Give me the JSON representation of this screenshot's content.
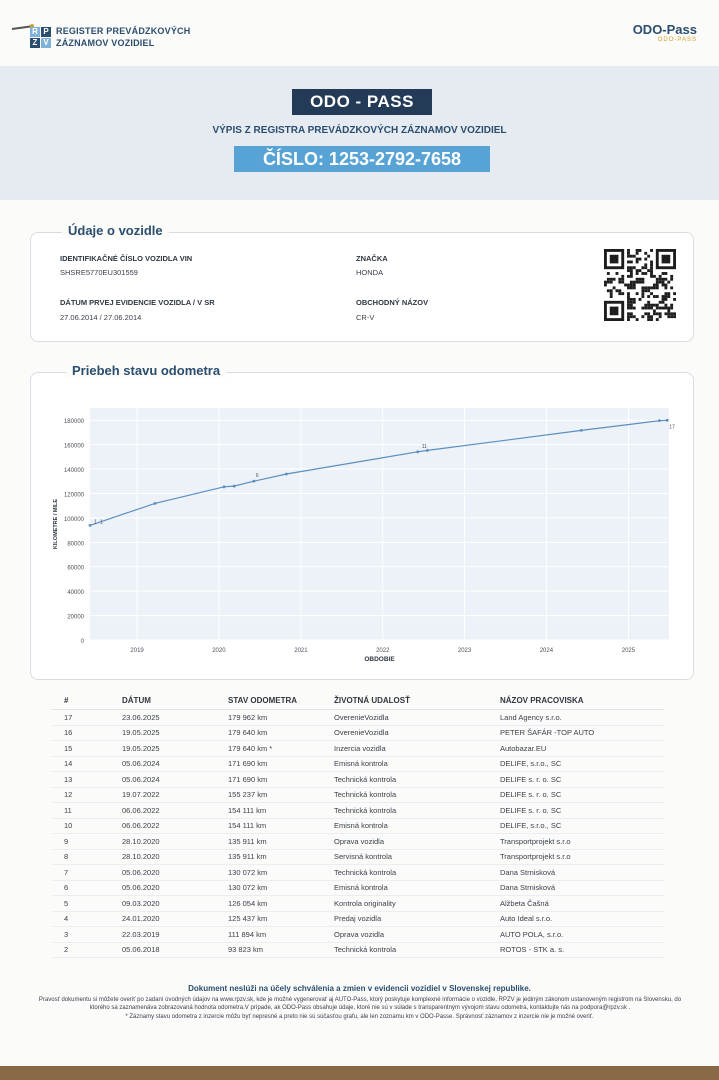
{
  "header": {
    "register_line1": "REGISTER PREVÁDZKOVÝCH",
    "register_line2": "ZÁZNAMOV VOZIDIEL",
    "odo_logo": "ODO-Pass",
    "odo_logo_sub": "ODO-PASS"
  },
  "title_block": {
    "badge": "ODO - PASS",
    "subtitle": "VÝPIS Z REGISTRA PREVÁDZKOVÝCH ZÁZNAMOV VOZIDIEL",
    "number": "ČÍSLO: 1253-2792-7658"
  },
  "vehicle": {
    "section_title": "Údaje o vozidle",
    "vin_label": "IDENTIFIKAČNÉ ČÍSLO VOZIDLA VIN",
    "vin_value": "SHSRE5770EU301559",
    "brand_label": "ZNAČKA",
    "brand_value": "HONDA",
    "first_reg_label": "DÁTUM PRVEJ EVIDENCIE VOZIDLA / V SR",
    "first_reg_value": "27.06.2014 / 27.06.2014",
    "trade_name_label": "OBCHODNÝ NÁZOV",
    "trade_name_value": "CR-V"
  },
  "odometer_section_title": "Priebeh stavu odometra",
  "chart_data": {
    "type": "line",
    "title": "",
    "xlabel": "OBDOBIE",
    "ylabel": "KILOMETRE / MILE",
    "ylim": [
      0,
      190000
    ],
    "xlim": [
      "2018-06-05",
      "2025-07-01"
    ],
    "x_ticks": [
      "2019",
      "2020",
      "2021",
      "2022",
      "2023",
      "2024",
      "2025"
    ],
    "y_ticks": [
      "0",
      "20000",
      "40000",
      "60000",
      "80000",
      "100000",
      "120000",
      "140000",
      "160000",
      "180000"
    ],
    "grid": true,
    "point_labels": [
      "1",
      "1",
      "6",
      "11",
      "17"
    ],
    "series": [
      {
        "color": "#5a8fc0",
        "points": [
          {
            "x": "2018-06-05",
            "y": 93823
          },
          {
            "x": "2019-03-22",
            "y": 111894
          },
          {
            "x": "2020-01-24",
            "y": 125437
          },
          {
            "x": "2020-03-09",
            "y": 126054
          },
          {
            "x": "2020-06-05",
            "y": 130072
          },
          {
            "x": "2020-10-28",
            "y": 135911
          },
          {
            "x": "2022-06-06",
            "y": 154111
          },
          {
            "x": "2022-07-19",
            "y": 155237
          },
          {
            "x": "2024-06-05",
            "y": 171690
          },
          {
            "x": "2025-05-19",
            "y": 179640
          },
          {
            "x": "2025-06-23",
            "y": 179962
          }
        ]
      }
    ]
  },
  "history": {
    "headers": [
      "#",
      "DÁTUM",
      "STAV ODOMETRA",
      "ŽIVOTNÁ UDALOSŤ",
      "NÁZOV PRACOVISKA"
    ],
    "rows": [
      [
        "17",
        "23.06.2025",
        "179 962 km",
        "OverenieVozidla",
        "Land Agency s.r.o."
      ],
      [
        "16",
        "19.05.2025",
        "179 640 km",
        "OverenieVozidla",
        "PETER ŠAFÁR -TOP AUTO"
      ],
      [
        "15",
        "19.05.2025",
        "179 640 km *",
        "Inzercia vozidla",
        "Autobazar.EU"
      ],
      [
        "14",
        "05.06.2024",
        "171 690 km",
        "Emisná kontrola",
        "DELIFE, s.r.o., SC"
      ],
      [
        "13",
        "05.06.2024",
        "171 690 km",
        "Technická kontrola",
        "DELIFE s. r. o. SC"
      ],
      [
        "12",
        "19.07.2022",
        "155 237 km",
        "Technická kontrola",
        "DELIFE s. r. o. SC"
      ],
      [
        "11",
        "06.06.2022",
        "154 111 km",
        "Technická kontrola",
        "DELIFE s. r. o. SC"
      ],
      [
        "10",
        "06.06.2022",
        "154 111 km",
        "Emisná kontrola",
        "DELIFE, s.r.o., SC"
      ],
      [
        "9",
        "28.10.2020",
        "135 911 km",
        "Oprava vozidla",
        "Transportprojekt s.r.o"
      ],
      [
        "8",
        "28.10.2020",
        "135 911 km",
        "Servisná kontrola",
        "Transportprojekt s.r.o"
      ],
      [
        "7",
        "05.06.2020",
        "130 072 km",
        "Technická kontrola",
        "Dana Strnisková"
      ],
      [
        "6",
        "05.06.2020",
        "130 072 km",
        "Emisná kontrola",
        "Dana Strnisková"
      ],
      [
        "5",
        "09.03.2020",
        "126 054 km",
        "Kontrola originality",
        "Alžbeta Čašná"
      ],
      [
        "4",
        "24.01.2020",
        "125 437 km",
        "Predaj vozidla",
        "Auto Ideal s.r.o."
      ],
      [
        "3",
        "22.03.2019",
        "111 894 km",
        "Oprava vozidla",
        "AUTO POLA, s.r.o."
      ],
      [
        "2",
        "05.06.2018",
        "93 823 km",
        "Technická kontrola",
        "ROTOS - STK a. s."
      ]
    ]
  },
  "footer": {
    "disclaimer": "Dokument neslúži na účely schválenia a zmien v evidencii vozidiel v Slovenskej republike.",
    "small_print": "Pravosť dokumentu si môžete overiť po zadaní úvodných údajov na www.rpzv.sk, kde je možné vygenerovať aj AUTO-Pass, ktorý poskytuje komplexné informácie o vozidle. RPZV je jediným zákonom ustanoveným registrom na Slovensku, do ktorého sa zaznamenáva zobrazovaná hodnota odometra.V prípade, ak ODO-Pass obsahuje údaje, ktoré nie sú v súlade s transparentným vývojom stavu odometra, kontaktujte nás na podpora@rpzv.sk .",
    "note": "* Záznamy stavu odometra z inzercie môžu byť nepresné a preto nie sú súčasťou grafu, ale len zoznamu km v ODO-Passe. Správnosť záznamov z inzercie nie je možné overiť."
  },
  "colors": {
    "navy": "#243b57",
    "accent_blue": "#58a3d6",
    "band": "#e6ebf1",
    "series_line": "#5a8fc0"
  }
}
